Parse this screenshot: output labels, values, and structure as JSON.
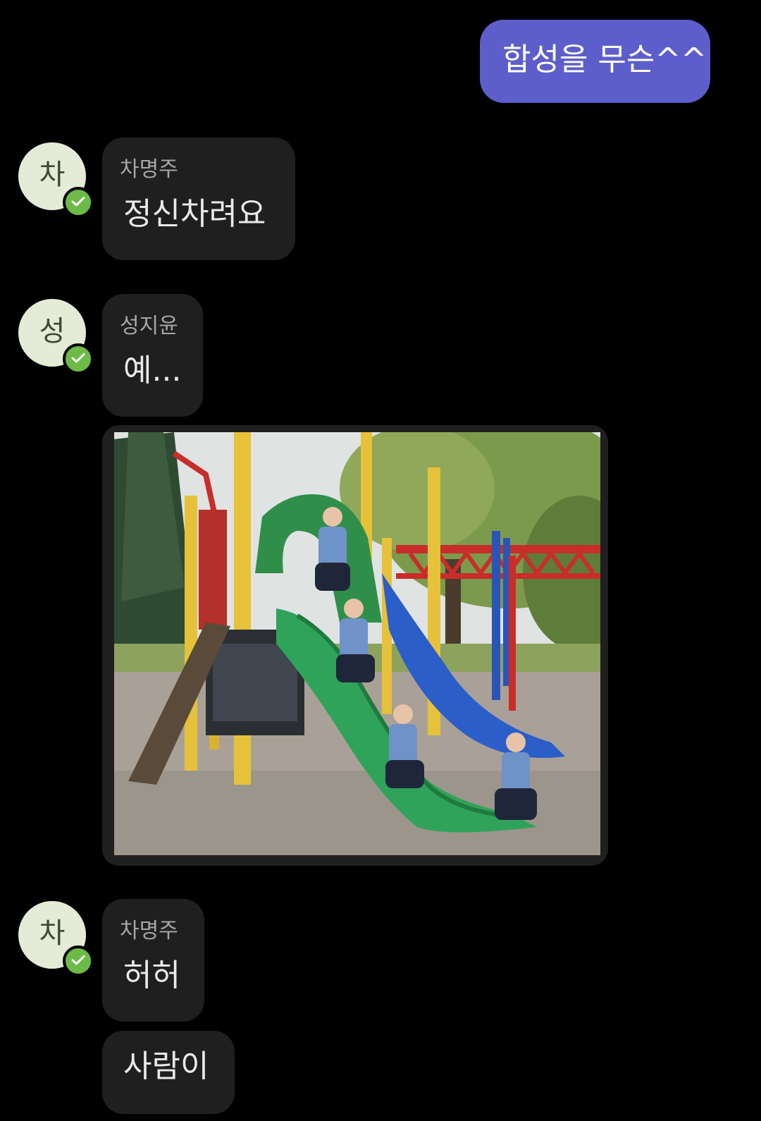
{
  "messages": {
    "outgoing_1": {
      "text": "합성을 무슨^^"
    },
    "incoming_1": {
      "avatar_initial": "차",
      "sender": "차명주",
      "text": "정신차려요"
    },
    "incoming_2": {
      "avatar_initial": "성",
      "sender": "성지윤",
      "text": "예..."
    },
    "incoming_3": {
      "avatar_initial": "차",
      "sender": "차명주",
      "text": "허허"
    },
    "incoming_4": {
      "text": "사람이"
    }
  },
  "colors": {
    "background": "#000000",
    "outgoing_bubble": "#5d5ecb",
    "incoming_bubble": "#1f1f1f",
    "avatar_background": "#e4ecd8",
    "verified_badge": "#6cbb47"
  },
  "icons": {
    "verified": "check-circle-icon"
  },
  "attachment": {
    "type": "image",
    "subject": "playground slide photo"
  }
}
